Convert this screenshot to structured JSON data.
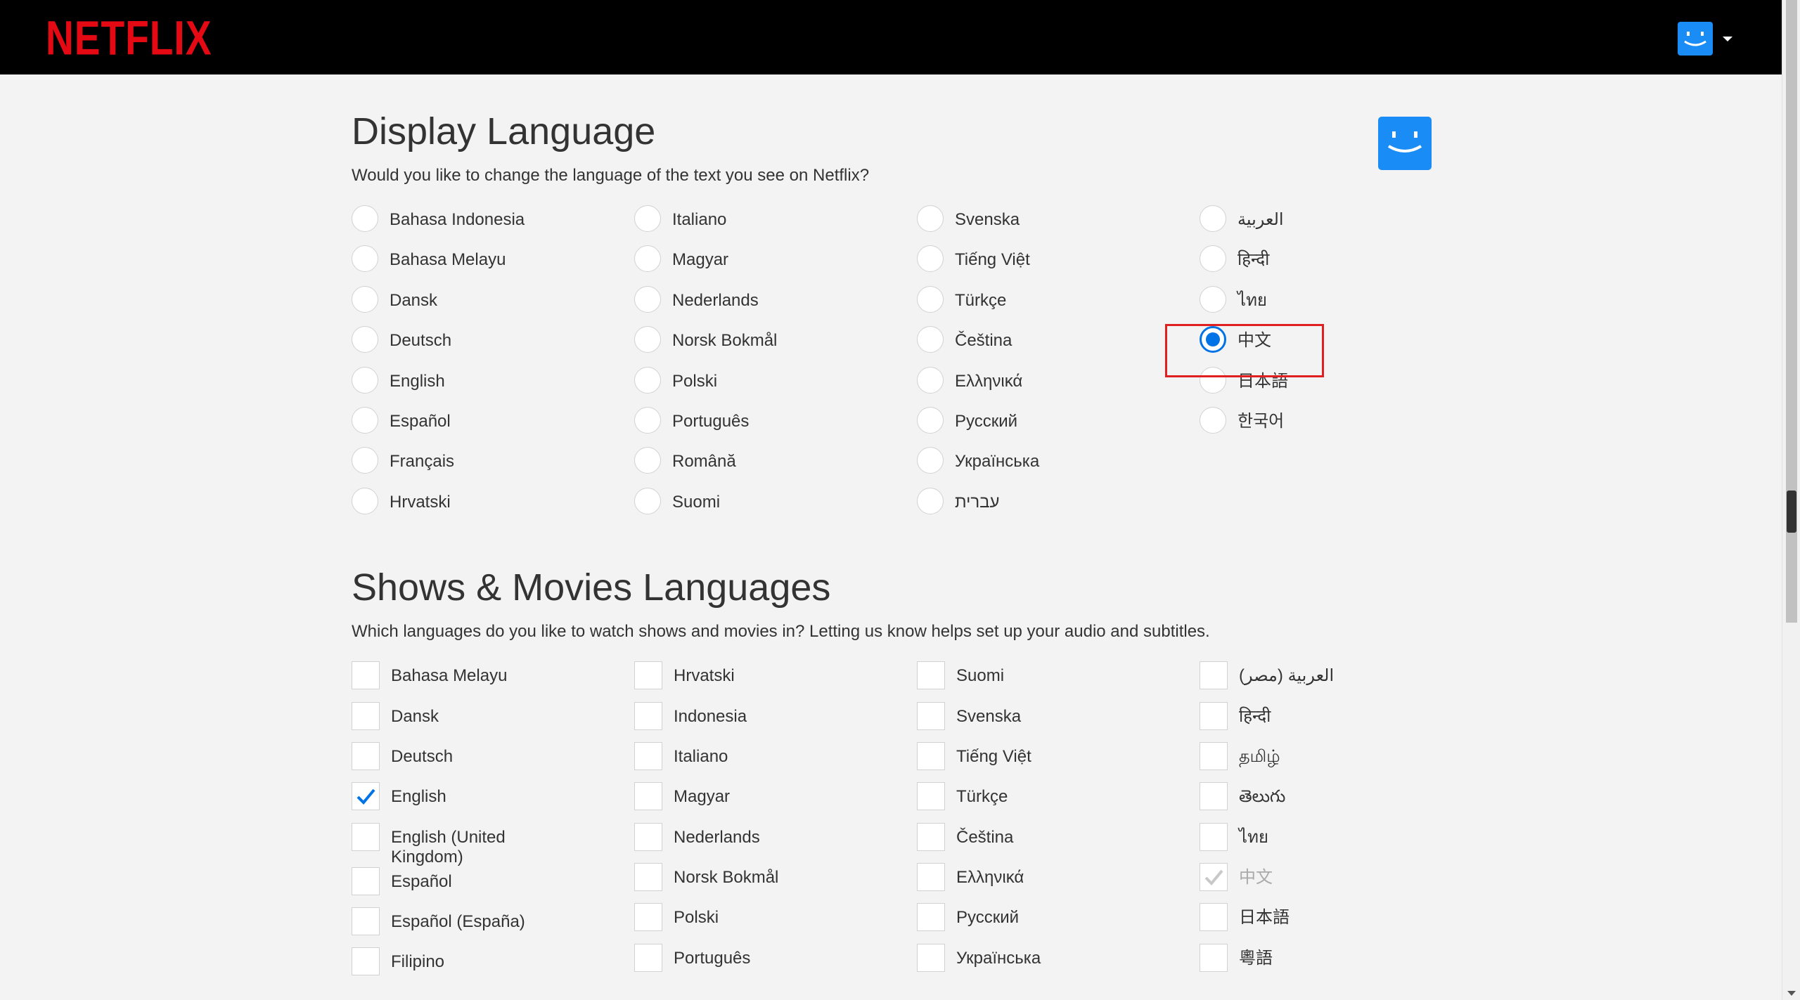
{
  "header": {
    "logo": "NETFLIX",
    "avatar_icon": "smiley-avatar-icon",
    "caret_icon": "caret-down-icon"
  },
  "colors": {
    "brand": "#e50914",
    "accent": "#0073e6",
    "avatar": "#1a8cf5",
    "highlight": "#e02020"
  },
  "display_language": {
    "title": "Display Language",
    "subtitle": "Would you like to change the language of the text you see on Netflix?",
    "selected": "中文",
    "columns": [
      [
        "Bahasa Indonesia",
        "Bahasa Melayu",
        "Dansk",
        "Deutsch",
        "English",
        "Español",
        "Français",
        "Hrvatski"
      ],
      [
        "Italiano",
        "Magyar",
        "Nederlands",
        "Norsk Bokmål",
        "Polski",
        "Português",
        "Română",
        "Suomi"
      ],
      [
        "Svenska",
        "Tiếng Việt",
        "Türkçe",
        "Čeština",
        "Ελληνικά",
        "Русский",
        "Українська",
        "עברית"
      ],
      [
        "العربية",
        "हिन्दी",
        "ไทย",
        "中文",
        "日本語",
        "한국어"
      ]
    ]
  },
  "shows_languages": {
    "title": "Shows & Movies Languages",
    "subtitle": "Which languages do you like to watch shows and movies in? Letting us know helps set up your audio and subtitles.",
    "columns": [
      [
        {
          "label": "Bahasa Melayu",
          "checked": false
        },
        {
          "label": "Dansk",
          "checked": false
        },
        {
          "label": "Deutsch",
          "checked": false
        },
        {
          "label": "English",
          "checked": true
        },
        {
          "label": "English (United Kingdom)",
          "checked": false
        },
        {
          "label": "Español",
          "checked": false
        },
        {
          "label": "Español (España)",
          "checked": false
        },
        {
          "label": "Filipino",
          "checked": false
        }
      ],
      [
        {
          "label": "Hrvatski",
          "checked": false
        },
        {
          "label": "Indonesia",
          "checked": false
        },
        {
          "label": "Italiano",
          "checked": false
        },
        {
          "label": "Magyar",
          "checked": false
        },
        {
          "label": "Nederlands",
          "checked": false
        },
        {
          "label": "Norsk Bokmål",
          "checked": false
        },
        {
          "label": "Polski",
          "checked": false
        },
        {
          "label": "Português",
          "checked": false
        }
      ],
      [
        {
          "label": "Suomi",
          "checked": false
        },
        {
          "label": "Svenska",
          "checked": false
        },
        {
          "label": "Tiếng Việt",
          "checked": false
        },
        {
          "label": "Türkçe",
          "checked": false
        },
        {
          "label": "Čeština",
          "checked": false
        },
        {
          "label": "Ελληνικά",
          "checked": false
        },
        {
          "label": "Русский",
          "checked": false
        },
        {
          "label": "Українська",
          "checked": false
        }
      ],
      [
        {
          "label": "العربية (مصر)",
          "checked": false
        },
        {
          "label": "हिन्दी",
          "checked": false
        },
        {
          "label": "தமிழ்",
          "checked": false
        },
        {
          "label": "తెలుగు",
          "checked": false
        },
        {
          "label": "ไทย",
          "checked": false
        },
        {
          "label": "中文",
          "checked": true,
          "disabled": true
        },
        {
          "label": "日本語",
          "checked": false
        },
        {
          "label": "粵語",
          "checked": false
        }
      ]
    ]
  }
}
